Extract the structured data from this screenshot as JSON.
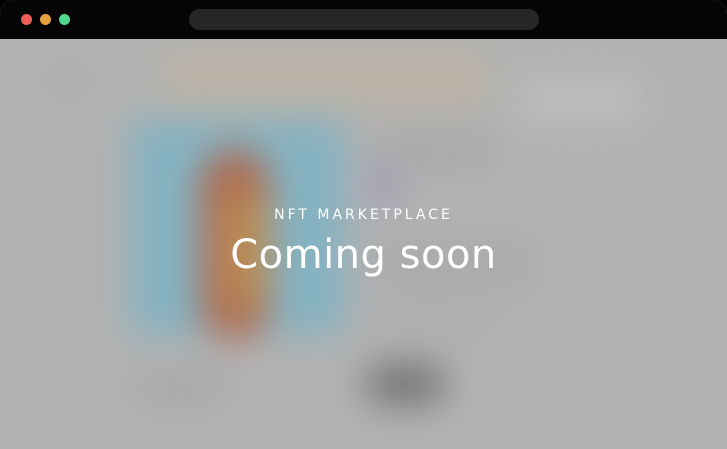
{
  "window": {
    "traffic_lights": {
      "close_color": "#ec5f57",
      "minimize_color": "#e6a23c",
      "zoom_color": "#4fd88f"
    },
    "address_bar": {
      "value": ""
    }
  },
  "page": {
    "eyebrow": "NFT MARKETPLACE",
    "headline": "Coming soon",
    "text_color": "#ffffff",
    "background_color": "#b7b7b7"
  }
}
